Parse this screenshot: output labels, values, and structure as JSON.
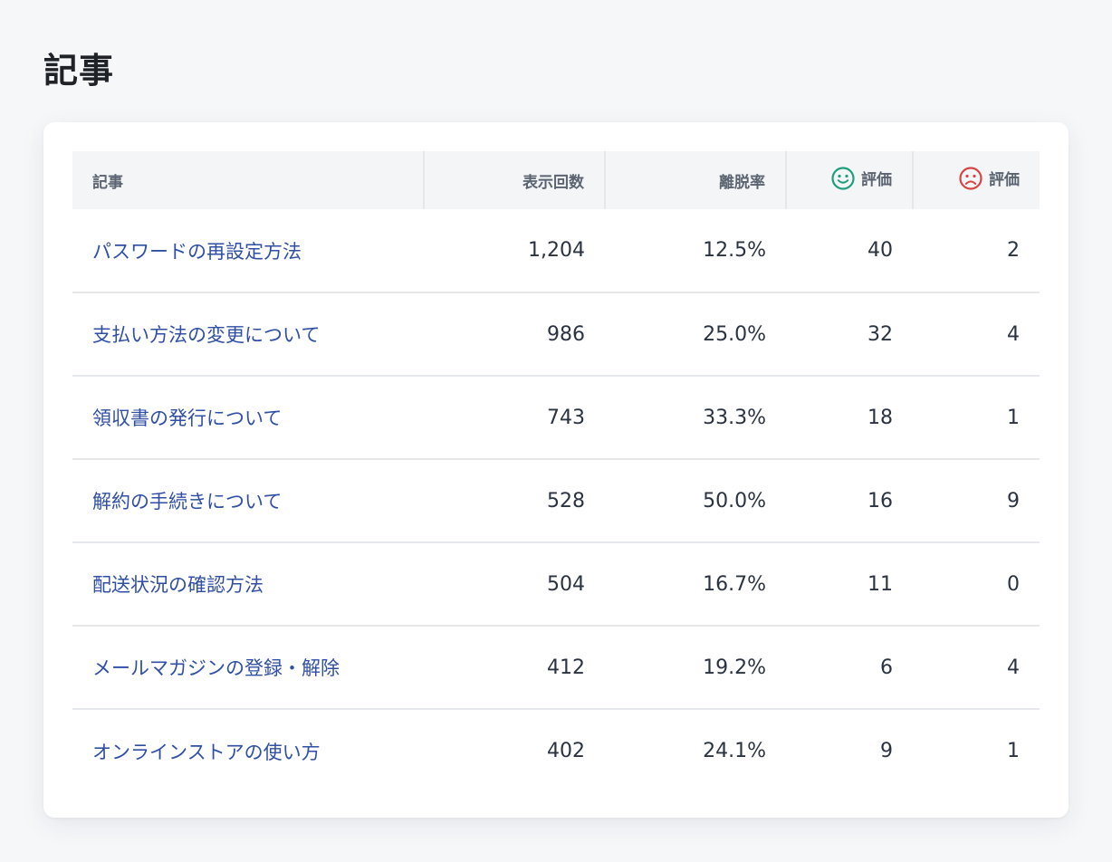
{
  "page": {
    "title": "記事"
  },
  "table": {
    "headers": {
      "article": "記事",
      "views": "表示回数",
      "bounce_rate": "離脱率",
      "good_rating": "評価",
      "bad_rating": "評価"
    },
    "icons": {
      "good": "smiley-face-icon",
      "bad": "frowning-face-icon"
    },
    "colors": {
      "good_icon": "#1f9e7d",
      "bad_icon": "#d64545",
      "link": "#2f4fa6",
      "header_bg": "#f3f5f7"
    },
    "rows": [
      {
        "article": "パスワードの再設定方法",
        "views": "1,204",
        "bounce_rate": "12.5%",
        "good": "40",
        "bad": "2"
      },
      {
        "article": "支払い方法の変更について",
        "views": "986",
        "bounce_rate": "25.0%",
        "good": "32",
        "bad": "4"
      },
      {
        "article": "領収書の発行について",
        "views": "743",
        "bounce_rate": "33.3%",
        "good": "18",
        "bad": "1"
      },
      {
        "article": "解約の手続きについて",
        "views": "528",
        "bounce_rate": "50.0%",
        "good": "16",
        "bad": "9"
      },
      {
        "article": "配送状況の確認方法",
        "views": "504",
        "bounce_rate": "16.7%",
        "good": "11",
        "bad": "0"
      },
      {
        "article": "メールマガジンの登録・解除",
        "views": "412",
        "bounce_rate": "19.2%",
        "good": "6",
        "bad": "4"
      },
      {
        "article": "オンラインストアの使い方",
        "views": "402",
        "bounce_rate": "24.1%",
        "good": "9",
        "bad": "1"
      }
    ]
  }
}
